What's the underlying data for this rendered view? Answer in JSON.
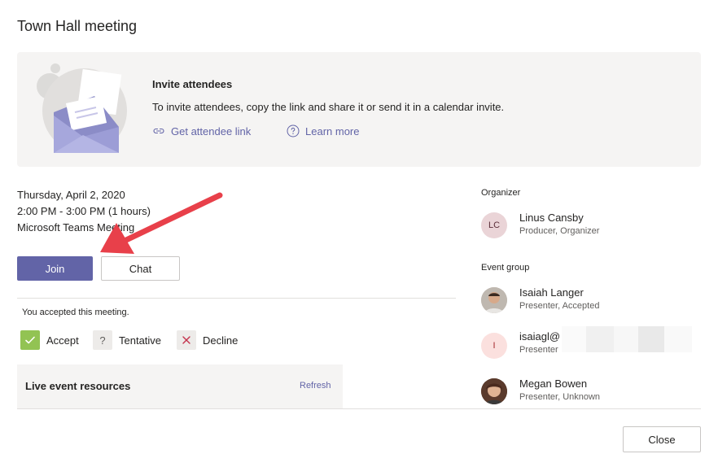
{
  "dialog": {
    "title": "Town Hall meeting"
  },
  "banner": {
    "title": "Invite attendees",
    "text": "To invite attendees, copy the link and share it or send it in a calendar invite.",
    "link_attendee": "Get attendee link",
    "link_learn": "Learn more"
  },
  "meeting": {
    "date": "Thursday, April 2, 2020",
    "time": "2:00 PM - 3:00 PM (1 hours)",
    "location": "Microsoft Teams Meeting"
  },
  "actions": {
    "join": "Join",
    "chat": "Chat"
  },
  "rsvp": {
    "status": "You accepted this meeting.",
    "accept": "Accept",
    "tentative": "Tentative",
    "tentative_glyph": "?",
    "decline": "Decline"
  },
  "resources": {
    "title": "Live event resources",
    "refresh": "Refresh"
  },
  "organizer": {
    "label": "Organizer",
    "initials": "LC",
    "name": "Linus Cansby",
    "role": "Producer, Organizer"
  },
  "event_group": {
    "label": "Event group",
    "members": [
      {
        "name": "Isaiah Langer",
        "role": "Presenter, Accepted"
      },
      {
        "initials": "I",
        "name": "isaiagl@",
        "role": "Presenter"
      },
      {
        "name": "Megan Bowen",
        "role": "Presenter, Unknown"
      }
    ]
  },
  "footer": {
    "close": "Close"
  },
  "colors": {
    "accent": "#6264a7",
    "accept_green": "#92c353",
    "decline_red": "#c4314b"
  }
}
